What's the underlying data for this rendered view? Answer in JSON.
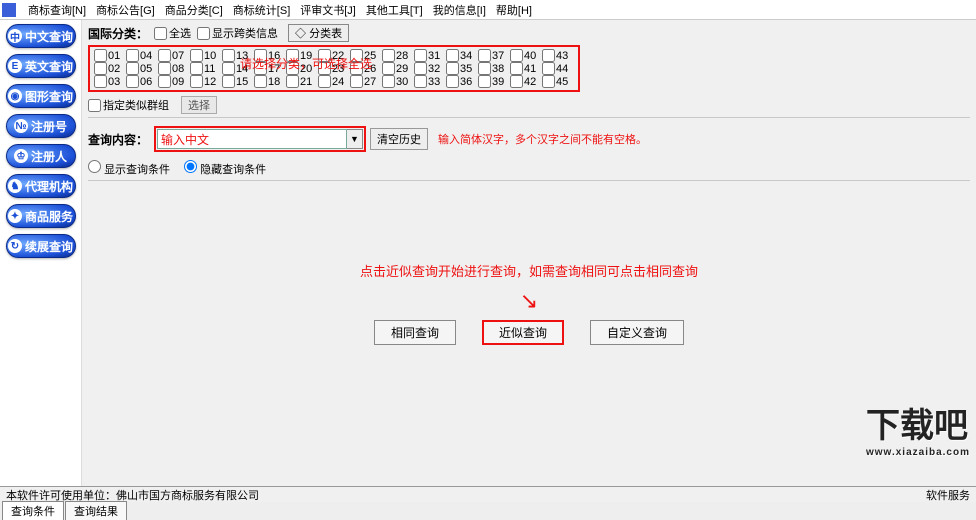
{
  "menu": [
    "商标查询[N]",
    "商标公告[G]",
    "商品分类[C]",
    "商标统计[S]",
    "评审文书[J]",
    "其他工具[T]",
    "我的信息[I]",
    "帮助[H]"
  ],
  "sidebar": [
    {
      "icon": "中",
      "label": "中文查询"
    },
    {
      "icon": "E",
      "label": "英文查询"
    },
    {
      "icon": "◉",
      "label": "图形查询"
    },
    {
      "icon": "№",
      "label": "注册号"
    },
    {
      "icon": "♔",
      "label": "注册人"
    },
    {
      "icon": "♞",
      "label": "代理机构"
    },
    {
      "icon": "✦",
      "label": "商品服务"
    },
    {
      "icon": "↻",
      "label": "续展查询"
    }
  ],
  "classify": {
    "label": "国际分类：",
    "all": "全选",
    "cross": "显示跨类信息",
    "treeBtn": "分类表",
    "overlay": "请选择分类，可选择全选",
    "groupChk": "指定类似群组",
    "selectBtn": "选择"
  },
  "nums": [
    "01",
    "04",
    "07",
    "10",
    "13",
    "16",
    "19",
    "22",
    "25",
    "28",
    "31",
    "34",
    "37",
    "40",
    "43",
    "02",
    "05",
    "08",
    "11",
    "14",
    "17",
    "20",
    "23",
    "26",
    "29",
    "32",
    "35",
    "38",
    "41",
    "44",
    "03",
    "06",
    "09",
    "12",
    "15",
    "18",
    "21",
    "24",
    "27",
    "30",
    "33",
    "36",
    "39",
    "42",
    "45"
  ],
  "query": {
    "label": "查询内容：",
    "placeholder": "输入中文",
    "clear": "清空历史",
    "hint": "输入简体汉字，多个汉字之间不能有空格。"
  },
  "radios": {
    "show": "显示查询条件",
    "hide": "隐藏查询条件"
  },
  "center": {
    "instr": "点击近似查询开始进行查询，如需查询相同可点击相同查询",
    "btn1": "相同查询",
    "btn2": "近似查询",
    "btn3": "自定义查询"
  },
  "status": {
    "left": "本软件许可使用单位：佛山市国方商标服务有限公司",
    "right": "软件服务"
  },
  "tabs": [
    "查询条件",
    "查询结果"
  ],
  "watermark": {
    "main": "下载吧",
    "sub": "www.xiazaiba.com"
  }
}
